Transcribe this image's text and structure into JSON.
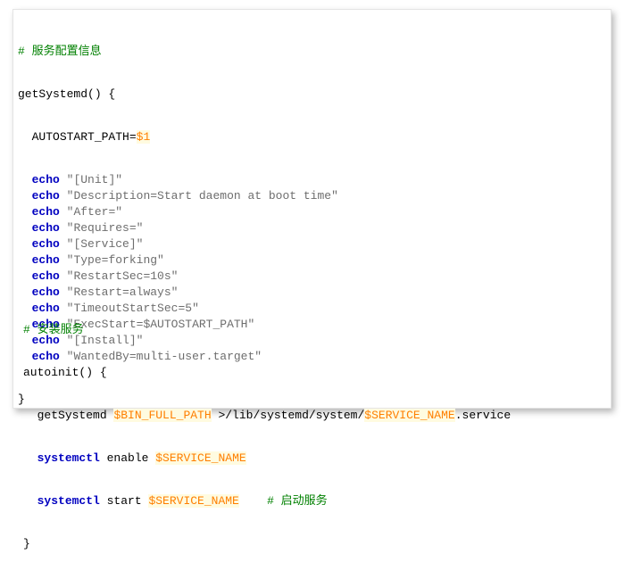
{
  "block1": {
    "comment": "# 服务配置信息",
    "func_open": "getSystemd() {",
    "autostart_prefix": "AUTOSTART_PATH=",
    "autostart_var": "$1",
    "echo_keyword": "echo",
    "echo_lines": [
      "\"[Unit]\"",
      "\"Description=Start daemon at boot time\"",
      "\"After=\"",
      "\"Requires=\"",
      "\"[Service]\"",
      "\"Type=forking\"",
      "\"RestartSec=10s\"",
      "\"Restart=always\"",
      "\"TimeoutStartSec=5\"",
      "\"ExecStart=$AUTOSTART_PATH\"",
      "\"[Install]\"",
      "\"WantedBy=multi-user.target\""
    ],
    "func_close": "}"
  },
  "block2": {
    "comment": "# 安装服务",
    "func_open": "autoinit() {",
    "line1_cmd": "getSystemd ",
    "line1_var1": "$BIN_FULL_PATH",
    "line1_mid": " >/lib/systemd/system/",
    "line1_var2": "$SERVICE_NAME",
    "line1_suffix": ".service",
    "systemctl_keyword": "systemctl",
    "line2_action": " enable ",
    "line2_var": "$SERVICE_NAME",
    "line3_action": " start ",
    "line3_var": "$SERVICE_NAME",
    "line3_comment": "# 启动服务",
    "func_close": "}"
  }
}
